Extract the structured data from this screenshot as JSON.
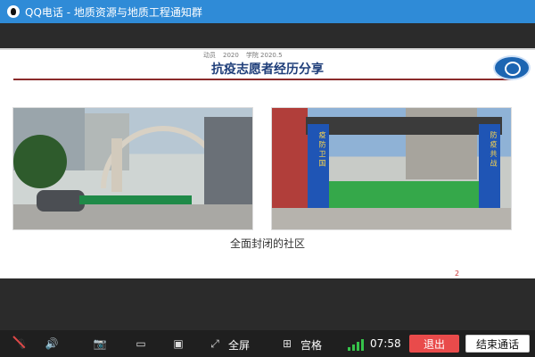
{
  "window": {
    "title": "QQ电话 - 地质资源与地质工程通知群"
  },
  "slide": {
    "title": "抗疫志愿者经历分享",
    "caption": "全面封闭的社区",
    "page_number": "2",
    "top_small_texts": [
      "动员 ",
      "2020 ",
      "学院 2020.5"
    ]
  },
  "photos": {
    "right_gate_left_text": "疫 防 卫 国",
    "right_gate_right_text": "防 疫 共 战"
  },
  "controls": {
    "fullscreen_label": "全屏",
    "grid_label": "宫格",
    "time": "07:58",
    "exit_button": "退出",
    "end_call_button": "结束通话"
  },
  "colors": {
    "titlebar_bg": "#2f8bd7",
    "control_bar_bg": "#1f1f1f",
    "exit_button_bg": "#e94b4b",
    "signal_green": "#36c24a",
    "slide_title_color": "#1f3e7a"
  }
}
